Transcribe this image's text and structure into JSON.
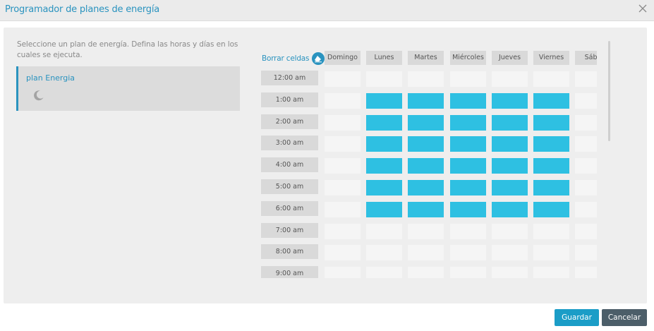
{
  "dialog": {
    "title": "Programador de planes de energía",
    "close_icon": "close-icon"
  },
  "left": {
    "instructions": "Seleccione un plan de energía. Defina las horas y días en los cuales se ejecuta.",
    "plan": {
      "name": "plan Energia",
      "icon": "moon-icon"
    }
  },
  "schedule": {
    "clear_label": "Borrar celdas",
    "clear_icon": "eraser-icon",
    "days": [
      "Domingo",
      "Lunes",
      "Martes",
      "Miércoles",
      "Jueves",
      "Viernes",
      "Sába"
    ],
    "hours": [
      "12:00 am",
      "1:00 am",
      "2:00 am",
      "3:00 am",
      "4:00 am",
      "5:00 am",
      "6:00 am",
      "7:00 am",
      "8:00 am",
      "9:00 am"
    ],
    "active": [
      [
        false,
        false,
        false,
        false,
        false,
        false,
        false
      ],
      [
        false,
        true,
        true,
        true,
        true,
        true,
        false
      ],
      [
        false,
        true,
        true,
        true,
        true,
        true,
        false
      ],
      [
        false,
        true,
        true,
        true,
        true,
        true,
        false
      ],
      [
        false,
        true,
        true,
        true,
        true,
        true,
        false
      ],
      [
        false,
        true,
        true,
        true,
        true,
        true,
        false
      ],
      [
        false,
        true,
        true,
        true,
        true,
        true,
        false
      ],
      [
        false,
        false,
        false,
        false,
        false,
        false,
        false
      ],
      [
        false,
        false,
        false,
        false,
        false,
        false,
        false
      ],
      [
        false,
        false,
        false,
        false,
        false,
        false,
        false
      ]
    ],
    "active_color": "#2ec0e2",
    "inactive_color": "#f5f5f5"
  },
  "buttons": {
    "save": "Guardar",
    "cancel": "Cancelar"
  }
}
